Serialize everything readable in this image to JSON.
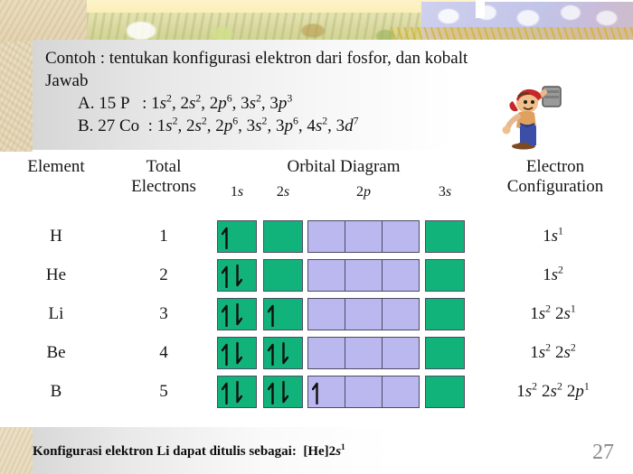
{
  "slide": {
    "page_number": "27",
    "intro": {
      "prompt": "Contoh : tentukan konfigurasi elektron dari fosfor, dan kobalt",
      "answer_label": "Jawab",
      "answers": [
        {
          "marker": "A.",
          "element": "15 P",
          "sep": ":",
          "configuration": "1s2, 2s2, 2p6, 3s2, 3p3"
        },
        {
          "marker": "B.",
          "element": "27 Co",
          "sep": ":",
          "configuration": "1s2, 2s2, 2p6, 3s2, 3p6, 4s2, 3d7"
        }
      ]
    },
    "footer": {
      "text": "Konfigurasi elektron Li dapat ditulis sebagai:",
      "notation": "[He]2s1"
    }
  },
  "table": {
    "headers": {
      "element": "Element",
      "total_line1": "Total",
      "total_line2": "Electrons",
      "orbital_diagram": "Orbital Diagram",
      "config_line1": "Electron",
      "config_line2": "Configuration"
    },
    "orbital_labels": [
      {
        "n": "1",
        "l": "s"
      },
      {
        "n": "2",
        "l": "s"
      },
      {
        "n": "2",
        "l": "p"
      },
      {
        "n": "3",
        "l": "s"
      }
    ],
    "colors": {
      "s_orbital_box": "#12b37b",
      "p_orbital_box": "#bbb8f0",
      "box_border": "#4b4b63",
      "arrow": "#101010"
    },
    "rows": [
      {
        "element": "H",
        "total_electrons": "1",
        "orbitals": {
          "1s": "up",
          "2s": "",
          "2p": [
            "",
            "",
            ""
          ],
          "3s": ""
        },
        "configuration": [
          {
            "n": "1",
            "l": "s",
            "e": "1"
          }
        ]
      },
      {
        "element": "He",
        "total_electrons": "2",
        "orbitals": {
          "1s": "updown",
          "2s": "",
          "2p": [
            "",
            "",
            ""
          ],
          "3s": ""
        },
        "configuration": [
          {
            "n": "1",
            "l": "s",
            "e": "2"
          }
        ]
      },
      {
        "element": "Li",
        "total_electrons": "3",
        "orbitals": {
          "1s": "updown",
          "2s": "up",
          "2p": [
            "",
            "",
            ""
          ],
          "3s": ""
        },
        "configuration": [
          {
            "n": "1",
            "l": "s",
            "e": "2"
          },
          {
            "n": "2",
            "l": "s",
            "e": "1"
          }
        ]
      },
      {
        "element": "Be",
        "total_electrons": "4",
        "orbitals": {
          "1s": "updown",
          "2s": "updown",
          "2p": [
            "",
            "",
            ""
          ],
          "3s": ""
        },
        "configuration": [
          {
            "n": "1",
            "l": "s",
            "e": "2"
          },
          {
            "n": "2",
            "l": "s",
            "e": "2"
          }
        ]
      },
      {
        "element": "B",
        "total_electrons": "5",
        "orbitals": {
          "1s": "updown",
          "2s": "updown",
          "2p": [
            "up",
            "",
            ""
          ],
          "3s": ""
        },
        "configuration": [
          {
            "n": "1",
            "l": "s",
            "e": "2"
          },
          {
            "n": "2",
            "l": "s",
            "e": "2"
          },
          {
            "n": "2",
            "l": "p",
            "e": "1"
          }
        ]
      }
    ]
  }
}
